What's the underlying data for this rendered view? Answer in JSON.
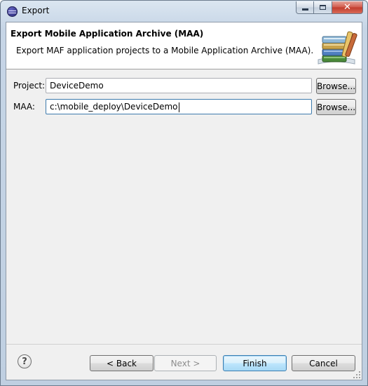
{
  "window": {
    "title": "Export"
  },
  "header": {
    "title": "Export Mobile Application Archive (MAA)",
    "description": "Export MAF application projects to a Mobile Application Archive (MAA).",
    "icon": "archive-books-icon"
  },
  "form": {
    "project": {
      "label": "Project:",
      "value": "DeviceDemo",
      "browse_label": "Browse..."
    },
    "maa": {
      "label": "MAA:",
      "value": "c:\\mobile_deploy\\DeviceDemo",
      "browse_label": "Browse..."
    }
  },
  "footer": {
    "help_symbol": "?",
    "back_label": "< Back",
    "next_label": "Next >",
    "finish_label": "Finish",
    "cancel_label": "Cancel"
  },
  "colors": {
    "finish_accent": "#3c7fb1",
    "close_button": "#c13b2c"
  }
}
